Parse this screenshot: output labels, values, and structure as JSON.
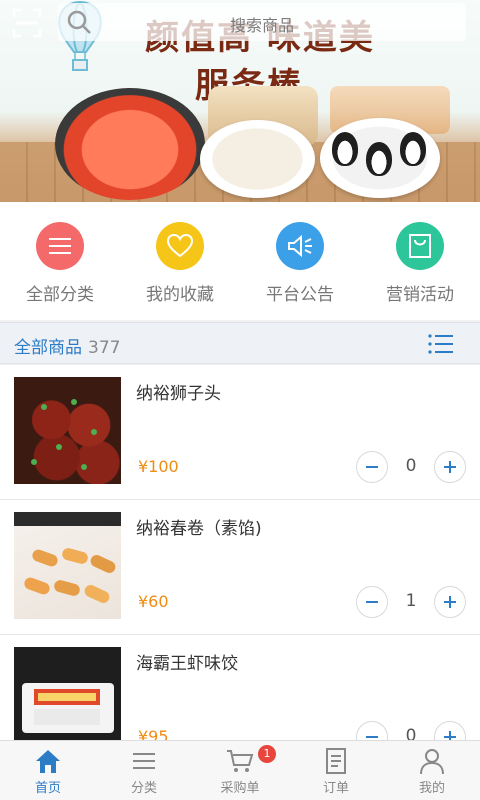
{
  "search": {
    "placeholder": "搜索商品"
  },
  "banner": {
    "headline_1": "颜值高 味道美",
    "headline_2": "服务棒"
  },
  "quick_nav": [
    {
      "label": "全部分类",
      "icon": "menu-icon",
      "color": "#f46a6a"
    },
    {
      "label": "我的收藏",
      "icon": "heart-icon",
      "color": "#f5c518"
    },
    {
      "label": "平台公告",
      "icon": "speaker-icon",
      "color": "#3ca0e8"
    },
    {
      "label": "营销活动",
      "icon": "bag-icon",
      "color": "#2dc59a"
    }
  ],
  "section": {
    "title": "全部商品",
    "count": "377"
  },
  "products": [
    {
      "name": "纳裕狮子头",
      "price": "¥100",
      "qty": "0"
    },
    {
      "name": "纳裕春卷（素馅)",
      "price": "¥60",
      "qty": "1"
    },
    {
      "name": "海霸王虾味饺",
      "price": "¥95",
      "qty": "0"
    }
  ],
  "tabbar": [
    {
      "label": "首页",
      "icon": "home-icon",
      "active": true
    },
    {
      "label": "分类",
      "icon": "category-icon",
      "active": false
    },
    {
      "label": "采购单",
      "icon": "cart-icon",
      "active": false,
      "badge": "1"
    },
    {
      "label": "订单",
      "icon": "order-icon",
      "active": false
    },
    {
      "label": "我的",
      "icon": "user-icon",
      "active": false
    }
  ],
  "colors": {
    "accent": "#2c7cc6",
    "price": "#f08c12",
    "badge": "#e8453c"
  }
}
